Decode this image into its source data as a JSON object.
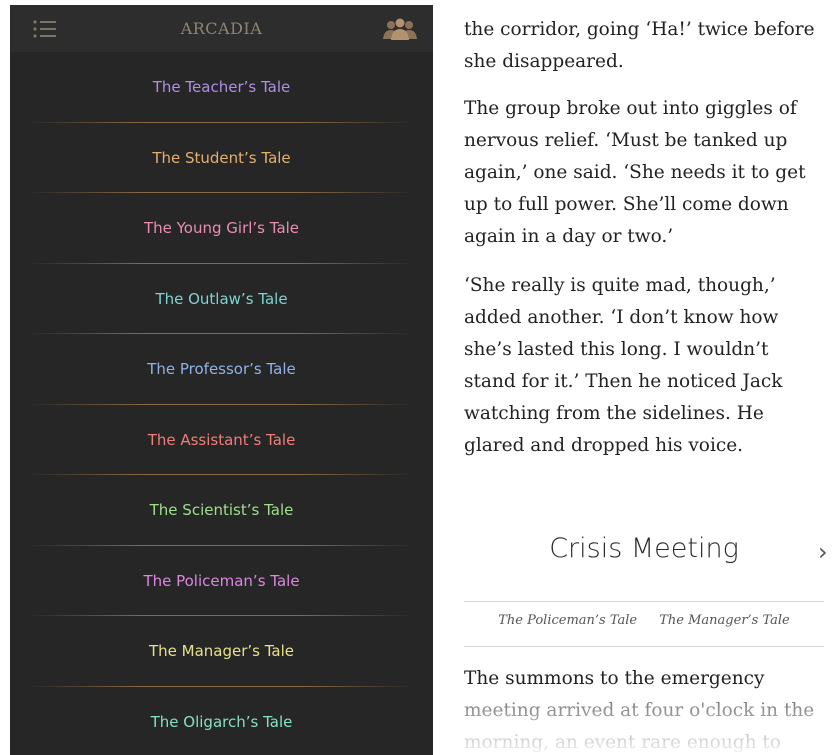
{
  "app": {
    "title": "ARCADIA"
  },
  "icons": {
    "menu": "list-menu-icon",
    "characters": "people-icon"
  },
  "tales": [
    {
      "label": "The Teacher’s Tale",
      "color": "#b08ee6"
    },
    {
      "label": "The Student’s Tale",
      "color": "#e3b070"
    },
    {
      "label": "The Young Girl’s Tale",
      "color": "#e88eb4"
    },
    {
      "label": "The Outlaw’s Tale",
      "color": "#7fd3d0"
    },
    {
      "label": "The Professor’s Tale",
      "color": "#8fb2e8"
    },
    {
      "label": "The Assistant’s Tale",
      "color": "#ee7e78"
    },
    {
      "label": "The Scientist’s Tale",
      "color": "#9ddf8d"
    },
    {
      "label": "The Policeman’s Tale",
      "color": "#dc86e0"
    },
    {
      "label": "The Manager’s Tale",
      "color": "#e7e08b"
    },
    {
      "label": "The Oligarch’s Tale",
      "color": "#83e0c4"
    }
  ],
  "reader": {
    "paragraph1": "the corridor, going ‘Ha!’ twice before she disappeared.",
    "paragraph2": "The group broke out into giggles of nervous relief. ‘Must be tanked up again,’ one said. ‘She needs it to get up to full power. She’ll come down again in a day or two.’",
    "paragraph3": "‘She really is quite mad, though,’ added another. ‘I don’t know how she’s lasted this long. I wouldn’t stand for it.’ Then he noticed Jack watching from the sidelines. He glared and dropped his voice.",
    "chapter_title": "Crisis Meeting",
    "next_chevron": "›",
    "nav_left": "The Policeman’s Tale",
    "nav_right": "The Manager’s Tale",
    "paragraph4": "The summons to the emergency meeting arrived at four o'clock in the morning, an event rare enough to"
  }
}
